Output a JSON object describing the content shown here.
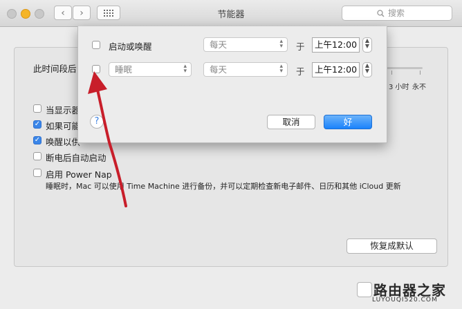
{
  "window": {
    "title": "节能器"
  },
  "toolbar": {
    "back_icon": "‹",
    "forward_icon": "›",
    "search_placeholder": "搜索"
  },
  "pane": {
    "sleep_label": "此时间段后",
    "slider_ticks": [
      "3 小时",
      "永不"
    ],
    "options": [
      {
        "label": "当显示器",
        "checked": false
      },
      {
        "label": "如果可能",
        "checked": true
      },
      {
        "label": "唤醒以供",
        "checked": true
      },
      {
        "label": "断电后自动启动",
        "checked": false
      },
      {
        "label": "启用 Power Nap",
        "checked": false
      }
    ],
    "power_nap_desc": "睡眠时，Mac 可以使用 Time Machine 进行备份，并可以定期检查新电子邮件、日历和其他 iCloud 更新",
    "restore_defaults": "恢复成默认"
  },
  "sheet": {
    "row1": {
      "label": "启动或唤醒",
      "frequency": "每天",
      "at": "于",
      "time": "上午12:00"
    },
    "row2": {
      "action": "睡眠",
      "frequency": "每天",
      "at": "于",
      "time": "上午12:00"
    },
    "help": "?",
    "cancel": "取消",
    "ok": "好"
  },
  "watermark": {
    "name": "路由器之家",
    "url": "LUYOUQI520.COM"
  },
  "colors": {
    "accent": "#1a82fb",
    "arrow": "#c81e2a"
  }
}
